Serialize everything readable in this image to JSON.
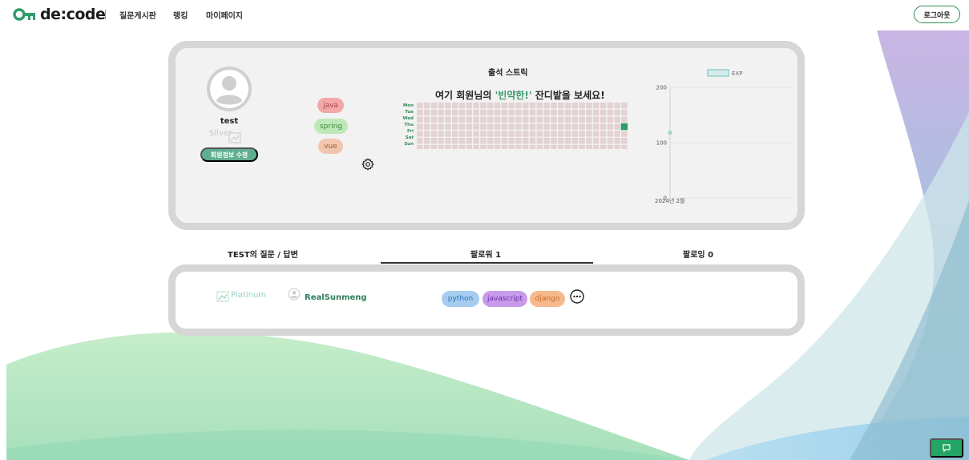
{
  "header": {
    "logo_text": "de:code",
    "nav": [
      "질문게시판",
      "랭킹",
      "마이페이지"
    ],
    "logout_label": "로그아웃"
  },
  "profile": {
    "username": "test",
    "tier": "Silver",
    "edit_label": "회원정보 수정",
    "skills": [
      "java",
      "spring",
      "vue"
    ]
  },
  "streak": {
    "title": "출석 스트릭",
    "subtitle_before": "여기 회원님의 ",
    "subtitle_highlight": "'빈약한!'",
    "subtitle_after": " 잔디밭을 보세요!",
    "days": [
      "Mon",
      "Tue",
      "Wed",
      "Thu",
      "Fri",
      "Sat",
      "Sun"
    ],
    "active_cell": {
      "row": 3,
      "col": 29
    },
    "colors": {
      "empty": "#e3d2d2",
      "active": "#2e9e6a"
    }
  },
  "chart_data": {
    "type": "line",
    "legend": [
      "EXP"
    ],
    "legend_position": "top",
    "x": [
      "2024년 2월"
    ],
    "series": [
      {
        "name": "EXP",
        "values": [
          118
        ]
      }
    ],
    "y_ticks": [
      "0",
      "100",
      "200"
    ],
    "ylim": [
      0,
      200
    ],
    "grid": true
  },
  "tabs": {
    "questions": "TEST의 질문 / 답변",
    "followers": "팔로워 1",
    "following": "팔로잉 0",
    "active": "followers"
  },
  "followers": [
    {
      "tier": "Platinum",
      "name": "RealSunmeng",
      "skills": [
        "python",
        "javascript",
        "django"
      ]
    }
  ],
  "colors": {
    "accent": "#2e8b57",
    "card_border": "#d6d6d6",
    "chat_button": "#22a565"
  }
}
